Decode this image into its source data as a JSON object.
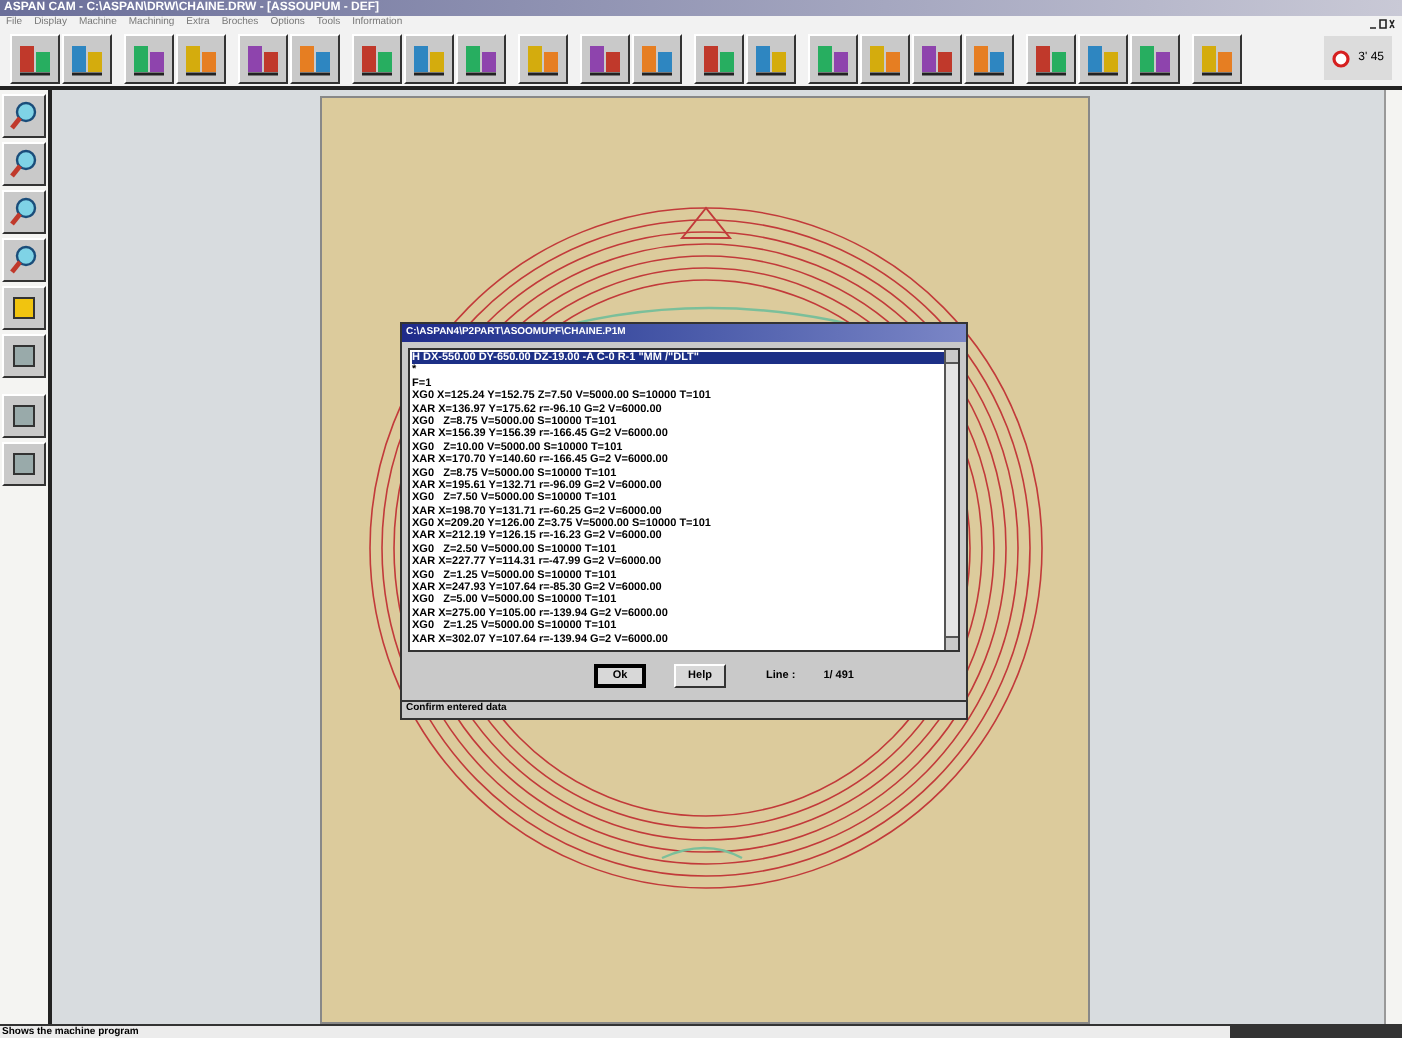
{
  "window": {
    "title": "ASPAN CAM - C:\\ASPAN\\DRW\\CHAINE.DRW - [ASSOUPUM - DEF]"
  },
  "menu": [
    "File",
    "Display",
    "Machine",
    "Machining",
    "Extra",
    "Broches",
    "Options",
    "Tools",
    "Information"
  ],
  "clock": {
    "text": "3' 45"
  },
  "dialog": {
    "title": "C:\\ASPAN4\\P2PART\\ASOOMUPF\\CHAINE.P1M",
    "lines": [
      {
        "text": "H DX-550.00 DY-650.00 DZ-19.00 -A C-0 R-1 \"MM /\"DLT\"",
        "selected": true
      },
      {
        "text": "*",
        "selected": false
      },
      {
        "text": "F=1",
        "selected": false
      },
      {
        "text": "XG0 X=125.24 Y=152.75 Z=7.50 V=5000.00 S=10000 T=101",
        "selected": false
      },
      {
        "text": "XAR X=136.97 Y=175.62 r=-96.10 G=2 V=6000.00",
        "selected": false
      },
      {
        "text": "XG0   Z=8.75 V=5000.00 S=10000 T=101",
        "selected": false
      },
      {
        "text": "XAR X=156.39 Y=156.39 r=-166.45 G=2 V=6000.00",
        "selected": false
      },
      {
        "text": "XG0   Z=10.00 V=5000.00 S=10000 T=101",
        "selected": false
      },
      {
        "text": "XAR X=170.70 Y=140.60 r=-166.45 G=2 V=6000.00",
        "selected": false
      },
      {
        "text": "XG0   Z=8.75 V=5000.00 S=10000 T=101",
        "selected": false
      },
      {
        "text": "XAR X=195.61 Y=132.71 r=-96.09 G=2 V=6000.00",
        "selected": false
      },
      {
        "text": "XG0   Z=7.50 V=5000.00 S=10000 T=101",
        "selected": false
      },
      {
        "text": "XAR X=198.70 Y=131.71 r=-60.25 G=2 V=6000.00",
        "selected": false
      },
      {
        "text": "XG0 X=209.20 Y=126.00 Z=3.75 V=5000.00 S=10000 T=101",
        "selected": false
      },
      {
        "text": "XAR X=212.19 Y=126.15 r=-16.23 G=2 V=6000.00",
        "selected": false
      },
      {
        "text": "XG0   Z=2.50 V=5000.00 S=10000 T=101",
        "selected": false
      },
      {
        "text": "XAR X=227.77 Y=114.31 r=-47.99 G=2 V=6000.00",
        "selected": false
      },
      {
        "text": "XG0   Z=1.25 V=5000.00 S=10000 T=101",
        "selected": false
      },
      {
        "text": "XAR X=247.93 Y=107.64 r=-85.30 G=2 V=6000.00",
        "selected": false
      },
      {
        "text": "XG0   Z=5.00 V=5000.00 S=10000 T=101",
        "selected": false
      },
      {
        "text": "XAR X=275.00 Y=105.00 r=-139.94 G=2 V=6000.00",
        "selected": false
      },
      {
        "text": "XG0   Z=1.25 V=5000.00 S=10000 T=101",
        "selected": false
      },
      {
        "text": "XAR X=302.07 Y=107.64 r=-139.94 G=2 V=6000.00",
        "selected": false
      }
    ],
    "buttons": [
      "Ok",
      "Help"
    ],
    "line_label": "Line :",
    "line_value": "1/ 491",
    "status": "Confirm entered data"
  },
  "status_bar": {
    "text": "Shows the machine program"
  }
}
